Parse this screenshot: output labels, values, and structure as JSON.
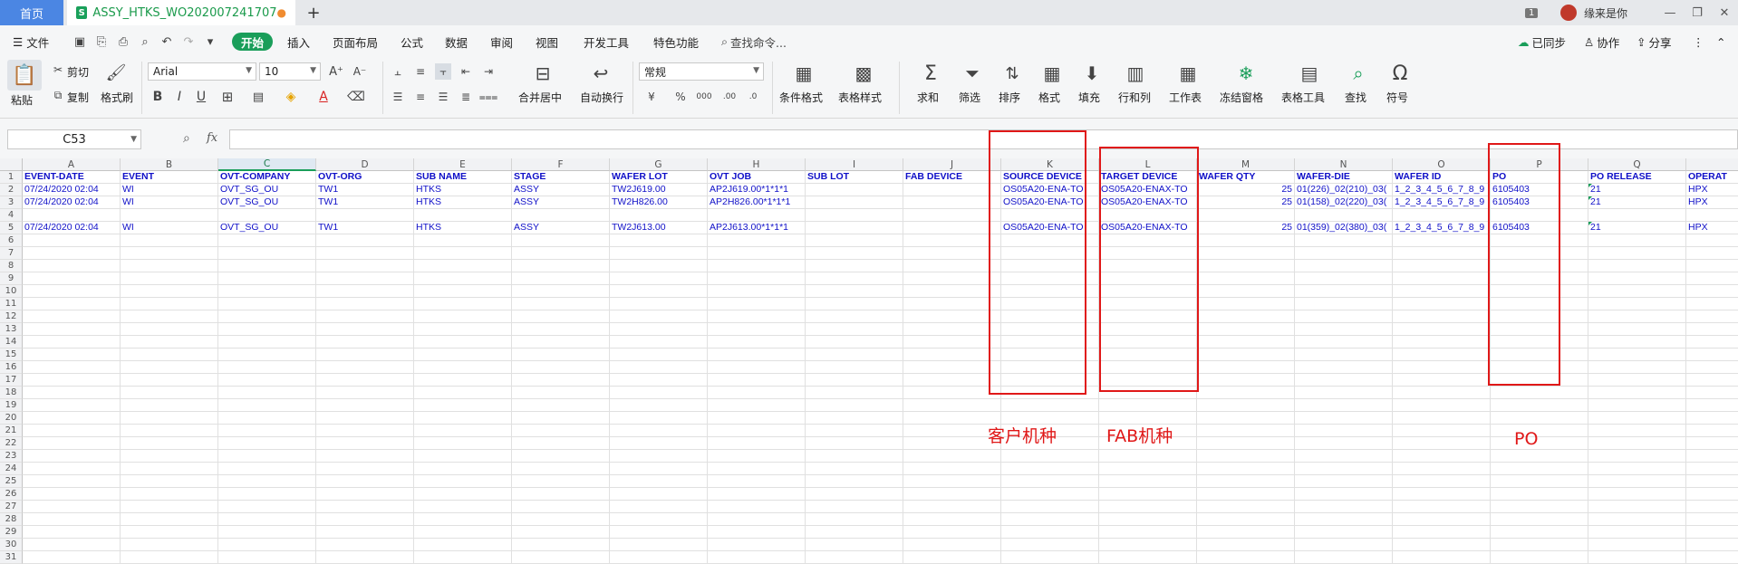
{
  "titlebar": {
    "home_tab": "首页",
    "doc_tab": "ASSY_HTKS_WO202007241707",
    "doc_icon": "S",
    "unsaved_dot": "●",
    "add_tab": "+",
    "badge": "1",
    "user_name": "缘来是你"
  },
  "menubar": {
    "file": "文件",
    "items": [
      "开始",
      "插入",
      "页面布局",
      "公式",
      "数据",
      "审阅",
      "视图",
      "开发工具",
      "特色功能"
    ],
    "search": "查找命令...",
    "right": [
      "已同步",
      "协作",
      "分享"
    ]
  },
  "ribbon": {
    "paste": "粘贴",
    "cut": "剪切",
    "copy": "复制",
    "format_painter": "格式刷",
    "font_name": "Arial",
    "font_size": "10",
    "merge": "合并居中",
    "wrap": "自动换行",
    "number_format": "常规",
    "cond_format": "条件格式",
    "table_style": "表格样式",
    "sum": "求和",
    "filter": "筛选",
    "sort": "排序",
    "format": "格式",
    "fill": "填充",
    "rowcol": "行和列",
    "worksheet": "工作表",
    "freeze": "冻结窗格",
    "table_tools": "表格工具",
    "find": "查找",
    "symbol": "符号"
  },
  "formula": {
    "cell_ref": "C53",
    "fx": "fx",
    "content": ""
  },
  "sheet": {
    "columns": [
      "A",
      "B",
      "C",
      "D",
      "E",
      "F",
      "G",
      "H",
      "I",
      "J",
      "K",
      "L",
      "M",
      "N",
      "O",
      "P",
      "Q",
      ""
    ],
    "headers": [
      "EVENT-DATE",
      "EVENT",
      "OVT-COMPANY",
      "OVT-ORG",
      "SUB NAME",
      "STAGE",
      "WAFER LOT",
      "OVT JOB",
      "SUB LOT",
      "FAB DEVICE",
      "SOURCE DEVICE",
      "TARGET DEVICE",
      "WAFER QTY",
      "WAFER-DIE",
      "WAFER ID",
      "PO",
      "PO RELEASE",
      "OPERAT"
    ],
    "data_rows": [
      {
        "row": 2,
        "cells": [
          "07/24/2020 02:04",
          "WI",
          "OVT_SG_OU",
          "TW1",
          "HTKS",
          "ASSY",
          "TW2J619.00",
          "AP2J619.00*1*1*1",
          "",
          "",
          "OS05A20-ENA-TO",
          "OS05A20-ENAX-TO",
          "25",
          "01(226)_02(210)_03(",
          "1_2_3_4_5_6_7_8_9",
          "6105403",
          "21",
          "HPX"
        ]
      },
      {
        "row": 3,
        "cells": [
          "07/24/2020 02:04",
          "WI",
          "OVT_SG_OU",
          "TW1",
          "HTKS",
          "ASSY",
          "TW2H826.00",
          "AP2H826.00*1*1*1",
          "",
          "",
          "OS05A20-ENA-TO",
          "OS05A20-ENAX-TO",
          "25",
          "01(158)_02(220)_03(",
          "1_2_3_4_5_6_7_8_9",
          "6105403",
          "21",
          "HPX"
        ]
      },
      {
        "row": 5,
        "cells": [
          "07/24/2020 02:04",
          "WI",
          "OVT_SG_OU",
          "TW1",
          "HTKS",
          "ASSY",
          "TW2J613.00",
          "AP2J613.00*1*1*1",
          "",
          "",
          "OS05A20-ENA-TO",
          "OS05A20-ENAX-TO",
          "25",
          "01(359)_02(380)_03(",
          "1_2_3_4_5_6_7_8_9",
          "6105403",
          "21",
          "HPX"
        ]
      }
    ]
  },
  "annotations": {
    "source_device": "客户机种",
    "target_device": "FAB机种",
    "po": "PO"
  },
  "colors": {
    "accent": "#1a9e5a",
    "home_tab": "#4b86e3",
    "cell_text": "#1010c8",
    "annotation": "#e01818"
  }
}
